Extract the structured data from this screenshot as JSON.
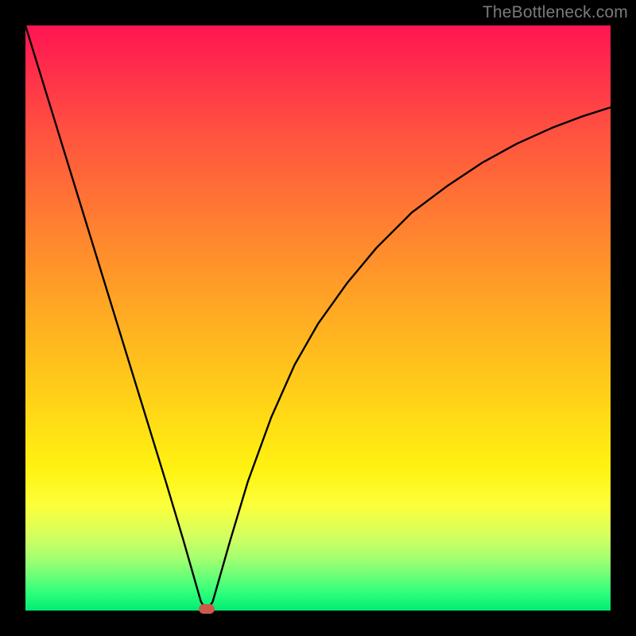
{
  "watermark": "TheBottleneck.com",
  "chart_data": {
    "type": "line",
    "title": "",
    "xlabel": "",
    "ylabel": "",
    "xlim": [
      0,
      100
    ],
    "ylim": [
      0,
      100
    ],
    "x_min_point": 31,
    "series": [
      {
        "name": "curve",
        "x": [
          0,
          4,
          8,
          12,
          16,
          20,
          24,
          27,
          29,
          30,
          31,
          32,
          33,
          35,
          38,
          42,
          46,
          50,
          55,
          60,
          66,
          72,
          78,
          84,
          90,
          95,
          100
        ],
        "values": [
          100,
          87,
          74,
          61,
          48,
          35,
          22,
          12,
          5,
          1.5,
          0,
          1.5,
          5,
          12,
          22,
          33,
          42,
          49,
          56,
          62,
          68,
          72.5,
          76.5,
          79.8,
          82.5,
          84.4,
          86
        ]
      }
    ],
    "marker": {
      "x": 31,
      "y": 0,
      "color": "#cc5a4a"
    },
    "gradient_stops": [
      {
        "pos": 0.0,
        "color": "#ff1552"
      },
      {
        "pos": 0.5,
        "color": "#ffc21c"
      },
      {
        "pos": 0.8,
        "color": "#fcff3a"
      },
      {
        "pos": 1.0,
        "color": "#00ec73"
      }
    ]
  }
}
